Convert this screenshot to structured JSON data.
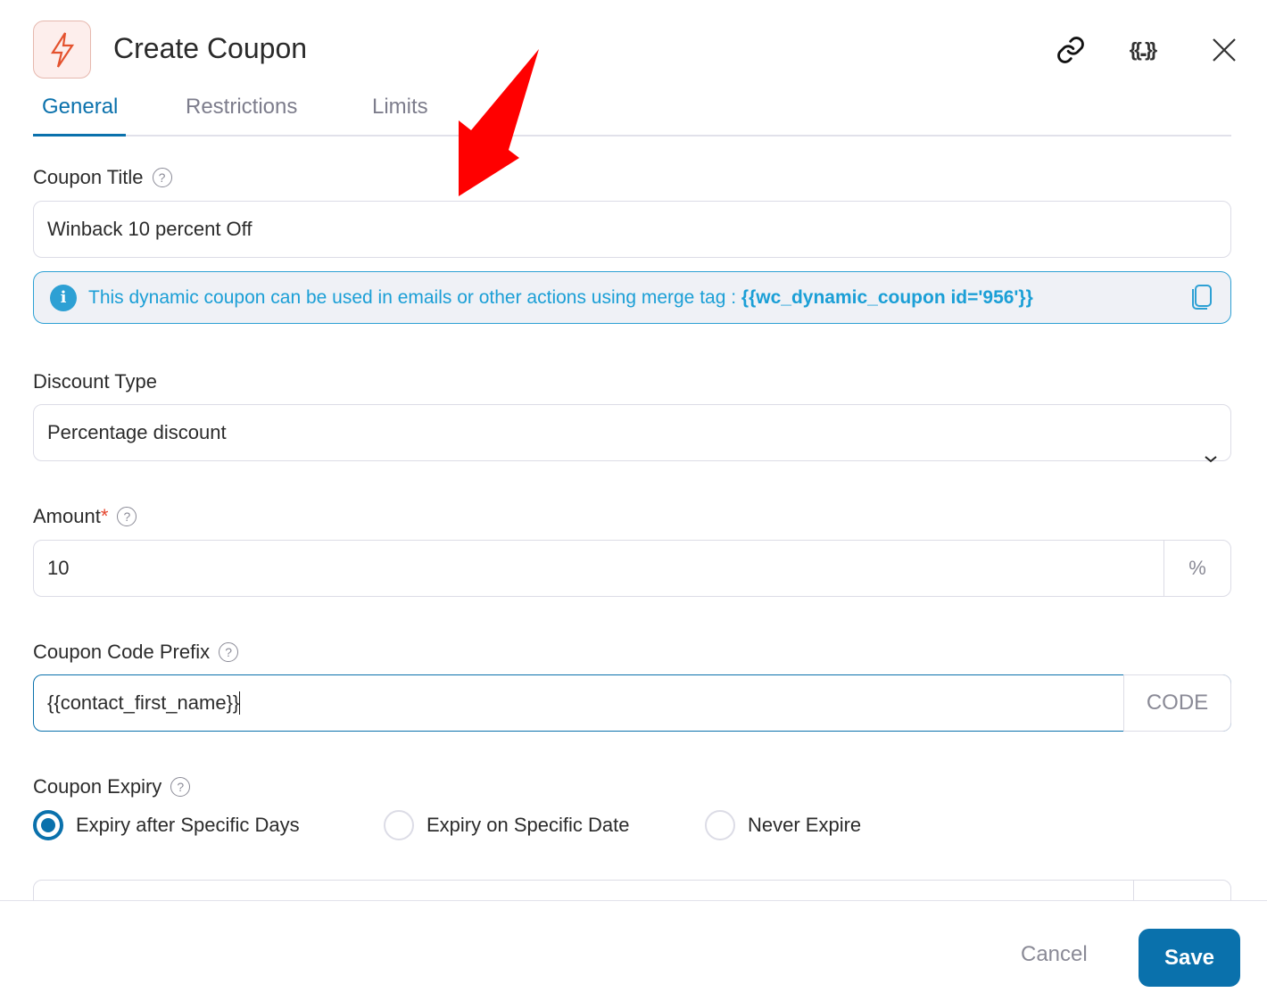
{
  "header": {
    "title": "Create Coupon",
    "icons": [
      "lightning-icon",
      "link-icon",
      "merge-tag-icon",
      "close-icon"
    ],
    "merge_tag_glyph": "{{..}}"
  },
  "tabs": [
    {
      "label": "General",
      "active": true
    },
    {
      "label": "Restrictions"
    },
    {
      "label": "Limits"
    }
  ],
  "coupon_title": {
    "label": "Coupon Title",
    "value": "Winback 10 percent Off"
  },
  "info": {
    "text": "This dynamic coupon can be used in emails or other actions using merge tag : ",
    "tag": "{{wc_dynamic_coupon id='956'}}"
  },
  "discount_type": {
    "label": "Discount Type",
    "value": "Percentage discount"
  },
  "amount": {
    "label": "Amount",
    "required": "*",
    "value": "10",
    "suffix": "%"
  },
  "prefix": {
    "label": "Coupon Code Prefix",
    "value": "{{contact_first_name}}",
    "suffix": "CODE"
  },
  "expiry": {
    "label": "Coupon Expiry",
    "options": [
      "Expiry after Specific Days",
      "Expiry on Specific Date",
      "Never Expire"
    ],
    "selected": "Expiry after Specific Days"
  },
  "footer": {
    "cancel": "Cancel",
    "save": "Save"
  },
  "colors": {
    "accent": "#0a71ac",
    "info": "#1b9fd6",
    "annotation": "#ff0000"
  }
}
